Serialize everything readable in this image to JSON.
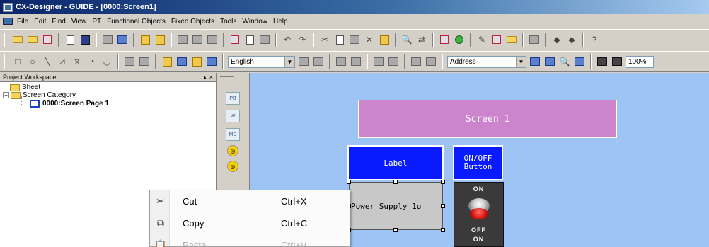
{
  "window": {
    "title": "CX-Designer - GUIDE - [0000:Screen1]"
  },
  "menubar": {
    "items": [
      "File",
      "Edit",
      "Find",
      "View",
      "PT",
      "Functional Objects",
      "Fixed Objects",
      "Tools",
      "Window",
      "Help"
    ]
  },
  "toolbar2": {
    "language": "English",
    "address": "Address",
    "zoom": "100%"
  },
  "workspace": {
    "title": "Project Workspace",
    "tree": [
      {
        "label": "Sheet",
        "bold": false
      },
      {
        "label": "Screen Category",
        "bold": false
      },
      {
        "label": "0000:Screen Page 1",
        "bold": true
      }
    ]
  },
  "palette": {
    "items": [
      "PB",
      "W",
      "MD"
    ]
  },
  "canvas": {
    "screen_title": "Screen 1",
    "label_object": "Label",
    "onoff_line1": "ON/OFF",
    "onoff_line2": "Button",
    "power_text": "Power Supply 1o",
    "switch_on_top": "ON",
    "switch_off": "OFF",
    "switch_on_bottom": "ON"
  },
  "context_menu": {
    "cut": {
      "label": "Cut",
      "shortcut": "Ctrl+X"
    },
    "copy": {
      "label": "Copy",
      "shortcut": "Ctrl+C"
    },
    "paste": {
      "label": "Paste",
      "shortcut": "Ctrl+V"
    }
  },
  "colors": {
    "canvas": "#9ec4f5",
    "screen_title_bg": "#cc84cc",
    "label_bg": "#0a1aff",
    "title_gradient_start": "#0a246a"
  }
}
